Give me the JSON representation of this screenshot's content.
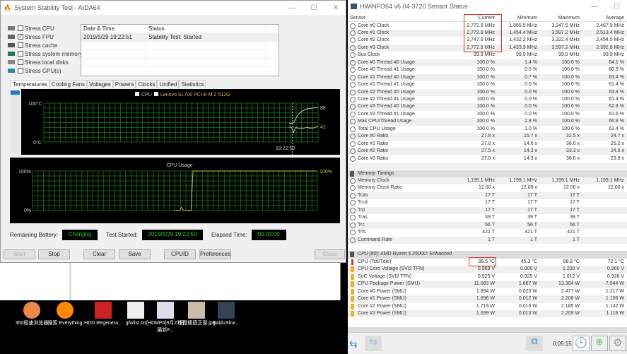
{
  "aida": {
    "title": "System Stability Test - AIDA64",
    "stress": [
      {
        "label": "Stress CPU",
        "checked": false
      },
      {
        "label": "Stress FPU",
        "checked": true
      },
      {
        "label": "Stress cache",
        "checked": false
      },
      {
        "label": "Stress system memory",
        "checked": false
      },
      {
        "label": "Stress local disks",
        "checked": false
      },
      {
        "label": "Stress GPU(s)",
        "checked": false
      }
    ],
    "log": {
      "headers": [
        "Date & Time",
        "Status"
      ],
      "rows": [
        [
          "2019/5/29 19:22:51",
          "Stability Test: Started"
        ]
      ]
    },
    "tabs": [
      "Temperatures",
      "Cooling Fans",
      "Voltages",
      "Powers",
      "Clocks",
      "Unified",
      "Statistics"
    ],
    "temp_graph": {
      "legend": [
        "CPU",
        "Lenovo SL700 PCI-E M.2 512G"
      ],
      "ymax": "100°C",
      "ymin": "0°C",
      "time": "19:22:50",
      "end_labels": [
        "88",
        "41"
      ],
      "cpu_series": [
        48,
        48,
        50,
        60,
        70,
        76,
        80,
        83,
        85,
        86,
        87,
        88,
        88,
        88
      ],
      "ssd_series": [
        38,
        38,
        25,
        38,
        35,
        35,
        35,
        36,
        38,
        36,
        36,
        36,
        39,
        41
      ]
    },
    "usage_graph": {
      "title": "CPU Usage",
      "ymax": "100%",
      "ymin": "0%",
      "end_label": "100%",
      "series": [
        0,
        0,
        1,
        0,
        8,
        0,
        0,
        0,
        1,
        0,
        100,
        100,
        100
      ]
    },
    "status": {
      "battery_label": "Remaining Battery:",
      "battery": "Charging",
      "started_label": "Test Started:",
      "started": "2019/5/29 19:22:50",
      "elapsed_label": "Elapsed Time:",
      "elapsed": "00:03:00"
    },
    "buttons": {
      "start": "Start",
      "stop": "Stop",
      "clear": "Clear",
      "save": "Save",
      "cpuid": "CPUID",
      "preferences": "Preferences",
      "close": "Close"
    }
  },
  "hwinfo": {
    "title": "HWiNFO64 v6.04-3720 Sensor Status",
    "headers": [
      "Sensor",
      "Current",
      "Minimum",
      "Maximum",
      "Average"
    ],
    "rows": [
      {
        "i": "c",
        "n": "Core #0 Clock",
        "v": [
          "2,772.9 MHz",
          "1,565.5 MHz",
          "3,247.5 MHz",
          "2,467.9 MHz"
        ]
      },
      {
        "i": "c",
        "n": "Core #1 Clock",
        "v": [
          "2,772.9 MHz",
          "1,454.4 MHz",
          "3,597.2 MHz",
          "2,513.4 MHz"
        ]
      },
      {
        "i": "c",
        "n": "Core #2 Clock",
        "v": [
          "2,747.9 MHz",
          "1,432.2 MHz",
          "3,322.4 MHz",
          "2,454.5 MHz"
        ]
      },
      {
        "i": "c",
        "n": "Core #3 Clock",
        "v": [
          "2,772.9 MHz",
          "1,423.9 MHz",
          "3,597.2 MHz",
          "2,392.8 MHz"
        ]
      },
      {
        "i": "c",
        "n": "Bus Clock",
        "v": [
          "99.9 MHz",
          "99.9 MHz",
          "99.9 MHz",
          "99.9 MHz"
        ]
      },
      {
        "i": "c",
        "n": "Core #0 Thread #0 Usage",
        "v": [
          "100.0 %",
          "1.4 %",
          "100.0 %",
          "64.1 %"
        ]
      },
      {
        "i": "c",
        "n": "Core #0 Thread #1 Usage",
        "v": [
          "100.0 %",
          "0.0 %",
          "100.0 %",
          "60.9 %"
        ]
      },
      {
        "i": "c",
        "n": "Core #1 Thread #0 Usage",
        "v": [
          "100.0 %",
          "0.7 %",
          "100.0 %",
          "63.4 %"
        ]
      },
      {
        "i": "c",
        "n": "Core #1 Thread #1 Usage",
        "v": [
          "100.0 %",
          "0.0 %",
          "100.0 %",
          "61.4 %"
        ]
      },
      {
        "i": "c",
        "n": "Core #2 Thread #0 Usage",
        "v": [
          "100.0 %",
          "0.0 %",
          "100.0 %",
          "63.8 %"
        ]
      },
      {
        "i": "c",
        "n": "Core #2 Thread #1 Usage",
        "v": [
          "100.0 %",
          "0.0 %",
          "100.0 %",
          "61.4 %"
        ]
      },
      {
        "i": "c",
        "n": "Core #3 Thread #0 Usage",
        "v": [
          "100.0 %",
          "0.0 %",
          "100.0 %",
          "62.8 %"
        ]
      },
      {
        "i": "c",
        "n": "Core #3 Thread #1 Usage",
        "v": [
          "100.0 %",
          "0.0 %",
          "100.0 %",
          "61.6 %"
        ]
      },
      {
        "i": "c",
        "n": "Max CPU/Thread Usage",
        "v": [
          "100.0 %",
          "2.8 %",
          "100.0 %",
          "66.8 %"
        ]
      },
      {
        "i": "c",
        "n": "Total CPU Usage",
        "v": [
          "100.0 %",
          "1.0 %",
          "100.0 %",
          "62.4 %"
        ]
      },
      {
        "i": "c",
        "n": "Core #0 Ratio",
        "v": [
          "27.8 x",
          "15.7 x",
          "32.5 x",
          "24.7 x"
        ]
      },
      {
        "i": "c",
        "n": "Core #1 Ratio",
        "v": [
          "27.8 x",
          "14.6 x",
          "36.0 x",
          "25.2 x"
        ]
      },
      {
        "i": "c",
        "n": "Core #2 Ratio",
        "v": [
          "27.5 x",
          "14.3 x",
          "33.3 x",
          "24.6 x"
        ]
      },
      {
        "i": "c",
        "n": "Core #3 Ratio",
        "v": [
          "27.8 x",
          "14.3 x",
          "36.0 x",
          "23.9 x"
        ]
      },
      {
        "i": "e",
        "n": "",
        "v": [
          "",
          "",
          "",
          ""
        ]
      },
      {
        "i": "g",
        "n": "Memory Timings",
        "v": [
          "",
          "",
          "",
          ""
        ]
      },
      {
        "i": "c",
        "n": "Memory Clock",
        "v": [
          "1,199.1 MHz",
          "1,199.1 MHz",
          "1,199.1 MHz",
          "1,199.1 MHz"
        ]
      },
      {
        "i": "c",
        "n": "Memory Clock Ratio",
        "v": [
          "12.00 x",
          "12.00 x",
          "12.00 x",
          "12.00 x"
        ]
      },
      {
        "i": "c",
        "n": "Tcas",
        "v": [
          "17 T",
          "17 T",
          "17 T",
          ""
        ]
      },
      {
        "i": "c",
        "n": "Trcd",
        "v": [
          "17 T",
          "17 T",
          "17 T",
          ""
        ]
      },
      {
        "i": "c",
        "n": "Trp",
        "v": [
          "17 T",
          "17 T",
          "17 T",
          ""
        ]
      },
      {
        "i": "c",
        "n": "Tras",
        "v": [
          "39 T",
          "39 T",
          "39 T",
          ""
        ]
      },
      {
        "i": "c",
        "n": "Trc",
        "v": [
          "56 T",
          "56 T",
          "56 T",
          ""
        ]
      },
      {
        "i": "c",
        "n": "Trfc",
        "v": [
          "421 T",
          "421 T",
          "421 T",
          ""
        ]
      },
      {
        "i": "c",
        "n": "Command Rate",
        "v": [
          "1 T",
          "1 T",
          "1 T",
          ""
        ]
      },
      {
        "i": "e",
        "n": "",
        "v": [
          "",
          "",
          "",
          ""
        ]
      },
      {
        "i": "g",
        "n": "CPU [#0]: AMD Ryzen 5 2500U: Enhanced",
        "v": [
          "",
          "",
          "",
          ""
        ]
      },
      {
        "i": "t",
        "n": "CPU (Tctl/Tdie)",
        "v": [
          "88.5 °C",
          "45.3 °C",
          "88.8 °C",
          "72.1 °C"
        ]
      },
      {
        "i": "p",
        "n": "CPU Core Voltage (SVI2 TFN)",
        "v": [
          "0.969 V",
          "0.800 V",
          "1.200 V",
          "0.960 V"
        ]
      },
      {
        "i": "p",
        "n": "SoC Voltage (SVI2 TFN)",
        "v": [
          "0.925 V",
          "0.925 V",
          "1.012 V",
          "0.926 V"
        ]
      },
      {
        "i": "p",
        "n": "CPU Package Power (SMU)",
        "v": [
          "11.083 W",
          "1.667 W",
          "13.304 W",
          "7.944 W"
        ]
      },
      {
        "i": "p",
        "n": "Core #0 Power (SMU)",
        "v": [
          "1.894 W",
          "0.023 W",
          "2.477 W",
          "1.217 W"
        ]
      },
      {
        "i": "p",
        "n": "Core #1 Power (SMU)",
        "v": [
          "1.696 W",
          "0.012 W",
          "2.206 W",
          "1.106 W"
        ]
      },
      {
        "i": "p",
        "n": "Core #2 Power (SMU)",
        "v": [
          "1.719 W",
          "0.016 W",
          "2.185 W",
          "1.142 W"
        ]
      },
      {
        "i": "p",
        "n": "Core #3 Power (SMU)",
        "v": [
          "1.699 W",
          "0.013 W",
          "2.209 W",
          "1.118 W"
        ]
      }
    ],
    "timer": "0:05:15"
  },
  "desktop": [
    {
      "label": "360极速浏览器",
      "color": "#e84"
    },
    {
      "label": "搜索 Everything",
      "color": "#f80"
    },
    {
      "label": "HDD Regenera...",
      "color": "#c22"
    },
    {
      "label": "gfwlist.txt",
      "color": "#eee"
    },
    {
      "label": "[HDMP4]9月27日 最新F...",
      "color": "#dde"
    },
    {
      "label": "棲霞棲庭正面.jpg",
      "color": "#cba"
    },
    {
      "label": "BaiduShur...",
      "color": "#345"
    }
  ]
}
